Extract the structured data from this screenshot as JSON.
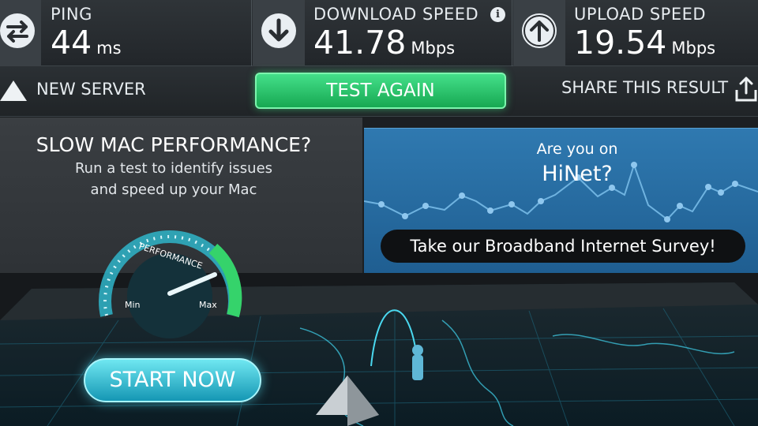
{
  "stats": {
    "ping": {
      "label": "PING",
      "value": "44",
      "unit": "ms",
      "icon": "ping-arrows-icon"
    },
    "download": {
      "label": "DOWNLOAD SPEED",
      "value": "41.78",
      "unit": "Mbps",
      "icon": "download-arrow-icon",
      "info": "i"
    },
    "upload": {
      "label": "UPLOAD SPEED",
      "value": "19.54",
      "unit": "Mbps",
      "icon": "upload-arrow-icon"
    }
  },
  "actions": {
    "new_server": "NEW SERVER",
    "test_again": "TEST AGAIN",
    "share": "SHARE THIS RESULT"
  },
  "ad": {
    "title": "SLOW MAC PERFORMANCE?",
    "line1": "Run a test to identify issues",
    "line2": "and speed up your Mac",
    "gauge_label": "PERFORMANCE",
    "min": "Min",
    "max": "Max",
    "cta": "START NOW"
  },
  "survey": {
    "line1": "Are you on",
    "isp": "HiNet?",
    "cta": "Take our Broadband Internet Survey!"
  },
  "colors": {
    "accent_green": "#2ecc71",
    "survey_blue": "#2a6ea3",
    "cyan": "#35d0e6",
    "dark_bg": "#1c1f22"
  }
}
